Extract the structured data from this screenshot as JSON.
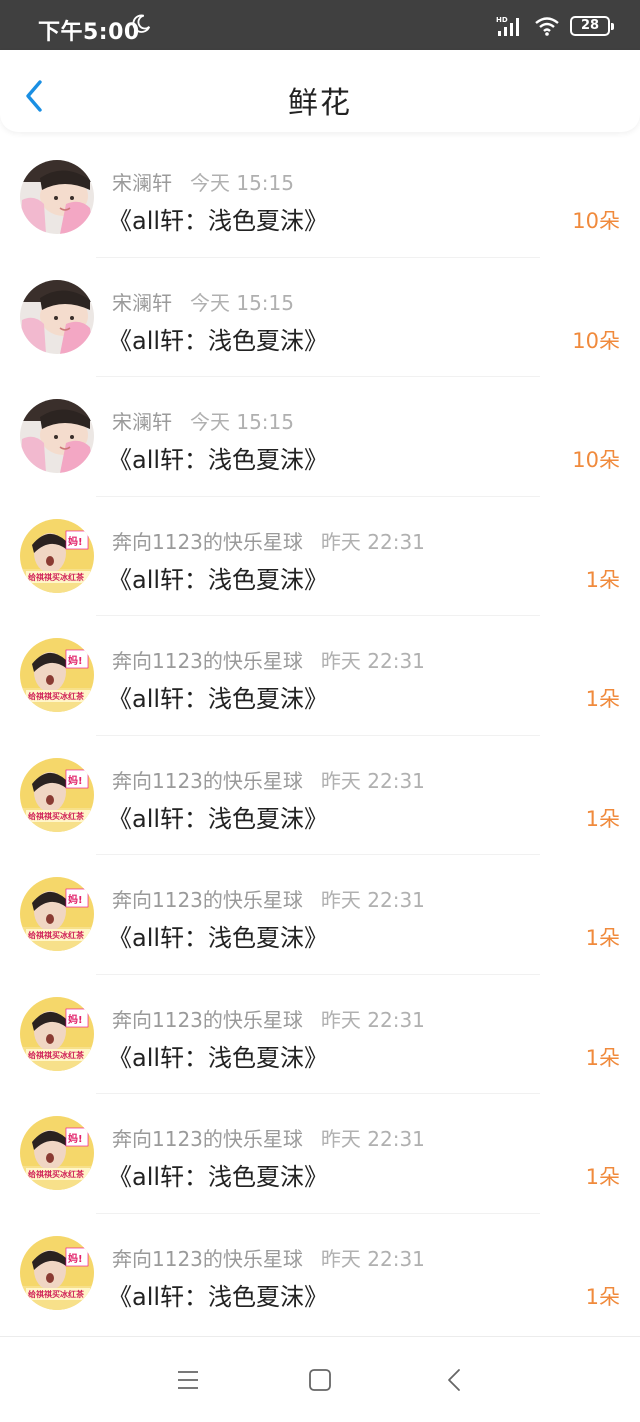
{
  "status_bar": {
    "time": "下午5:00",
    "battery": "28",
    "icons": [
      "moon-icon",
      "hd-signal-icon",
      "wifi-icon",
      "battery-icon"
    ]
  },
  "header": {
    "title": "鲜花",
    "back_icon": "chevron-left-icon"
  },
  "colors": {
    "accent": "#f08a3c",
    "back_blue": "#1a8fe3",
    "status_bar_bg": "#404040"
  },
  "items": [
    {
      "name": "宋澜轩",
      "time": "今天 15:15",
      "title": "《all轩：浅色夏沫》",
      "count": "10朵",
      "avatar": "avatar-pink-pillow"
    },
    {
      "name": "宋澜轩",
      "time": "今天 15:15",
      "title": "《all轩：浅色夏沫》",
      "count": "10朵",
      "avatar": "avatar-pink-pillow"
    },
    {
      "name": "宋澜轩",
      "time": "今天 15:15",
      "title": "《all轩：浅色夏沫》",
      "count": "10朵",
      "avatar": "avatar-pink-pillow"
    },
    {
      "name": "奔向1123的快乐星球",
      "time": "昨天 22:31",
      "title": "《all轩：浅色夏沫》",
      "count": "1朵",
      "avatar": "avatar-yellow-poster"
    },
    {
      "name": "奔向1123的快乐星球",
      "time": "昨天 22:31",
      "title": "《all轩：浅色夏沫》",
      "count": "1朵",
      "avatar": "avatar-yellow-poster"
    },
    {
      "name": "奔向1123的快乐星球",
      "time": "昨天 22:31",
      "title": "《all轩：浅色夏沫》",
      "count": "1朵",
      "avatar": "avatar-yellow-poster"
    },
    {
      "name": "奔向1123的快乐星球",
      "time": "昨天 22:31",
      "title": "《all轩：浅色夏沫》",
      "count": "1朵",
      "avatar": "avatar-yellow-poster"
    },
    {
      "name": "奔向1123的快乐星球",
      "time": "昨天 22:31",
      "title": "《all轩：浅色夏沫》",
      "count": "1朵",
      "avatar": "avatar-yellow-poster"
    },
    {
      "name": "奔向1123的快乐星球",
      "time": "昨天 22:31",
      "title": "《all轩：浅色夏沫》",
      "count": "1朵",
      "avatar": "avatar-yellow-poster"
    },
    {
      "name": "奔向1123的快乐星球",
      "time": "昨天 22:31",
      "title": "《all轩：浅色夏沫》",
      "count": "1朵",
      "avatar": "avatar-yellow-poster"
    }
  ],
  "bottom_nav": {
    "icons": [
      "menu-icon",
      "home-square-icon",
      "back-triangle-icon"
    ]
  }
}
